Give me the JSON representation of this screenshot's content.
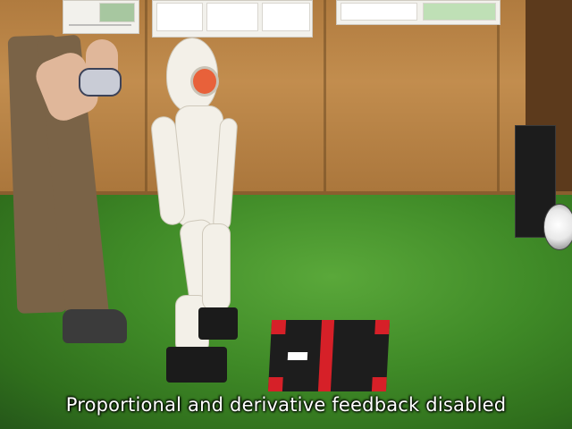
{
  "scene": {
    "description_items": [
      "wooden-wall",
      "posters",
      "grass-floor",
      "person",
      "controller",
      "humanoid-robot",
      "notebook",
      "computer-tower",
      "soccer-ball"
    ]
  },
  "caption": {
    "text": "Proportional and derivative feedback disabled"
  },
  "colors": {
    "wall": "#c28d4e",
    "grass": "#3f8a27",
    "robot_body": "#f3f0e8",
    "robot_face": "#e8613a",
    "notebook": "#1d1d1d",
    "notebook_accent": "#d62028",
    "caption_text": "#ffffff"
  }
}
